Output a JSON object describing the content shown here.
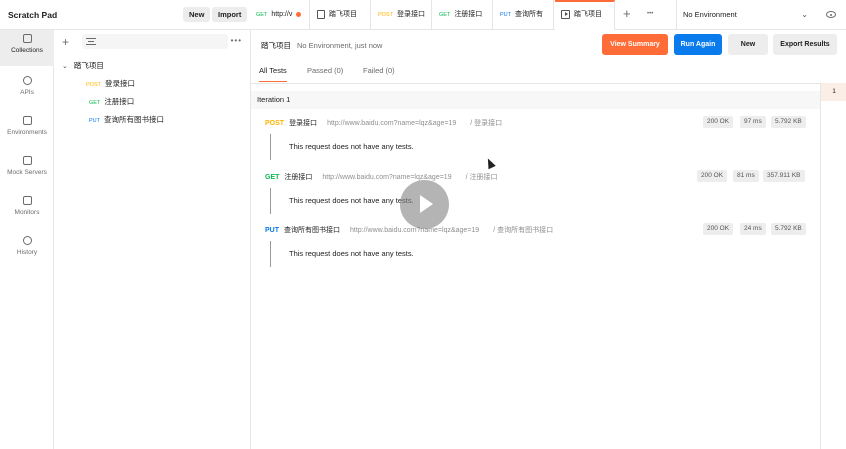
{
  "header": {
    "workspace": "Scratch Pad",
    "new_label": "New",
    "import_label": "Import"
  },
  "tabs": [
    {
      "method": "GET",
      "label": "http://v",
      "dirty": true
    },
    {
      "method": "",
      "label": "踏飞项目",
      "icon": "collection-icon"
    },
    {
      "method": "POST",
      "label": "登录接口"
    },
    {
      "method": "GET",
      "label": "注册接口"
    },
    {
      "method": "PUT",
      "label": "查询所有"
    },
    {
      "method": "",
      "label": "踏飞项目",
      "icon": "runner-icon",
      "active": true
    }
  ],
  "tab_controls": {
    "add": "+",
    "more": "•••"
  },
  "environment": {
    "selected": "No Environment",
    "chevron": "⌄"
  },
  "rail": [
    {
      "label": "Collections",
      "icon": "collections-icon",
      "active": true
    },
    {
      "label": "APIs",
      "icon": "apis-icon"
    },
    {
      "label": "Environments",
      "icon": "environments-icon"
    },
    {
      "label": "Mock Servers",
      "icon": "mock-servers-icon"
    },
    {
      "label": "Monitors",
      "icon": "monitors-icon"
    },
    {
      "label": "History",
      "icon": "history-icon"
    }
  ],
  "sidebar": {
    "add": "+",
    "more": "•••",
    "collection": "踏飞项目",
    "caret": "⌄",
    "requests": [
      {
        "method": "POST",
        "name": "登录接口"
      },
      {
        "method": "GET",
        "name": "注册接口"
      },
      {
        "method": "PUT",
        "name": "查询所有图书接口"
      }
    ]
  },
  "runner": {
    "title": "踏飞项目",
    "subtitle": "No Environment, just now",
    "buttons": {
      "view_summary": "View Summary",
      "run_again": "Run Again",
      "new": "New",
      "export": "Export Results"
    },
    "tabs": {
      "all": "All Tests",
      "passed": "Passed (0)",
      "failed": "Failed (0)"
    },
    "iteration": "Iteration 1",
    "iteration_number": "1",
    "results": [
      {
        "method": "POST",
        "name": "登录接口",
        "url": "http://www.baidu.com?name=lqz&age=19",
        "path": "/ 登录接口",
        "status": "200 OK",
        "time": "97 ms",
        "size": "5.792 KB",
        "note": "This request does not have any tests."
      },
      {
        "method": "GET",
        "name": "注册接口",
        "url": "http://www.baidu.com?name=lqz&age=19",
        "path": "/ 注册接口",
        "status": "200 OK",
        "time": "81 ms",
        "size": "357.911 KB",
        "note": "This request does not have any tests."
      },
      {
        "method": "PUT",
        "name": "查询所有图书接口",
        "url": "http://www.baidu.com?name=lqz&age=19",
        "path": "/ 查询所有图书接口",
        "status": "200 OK",
        "time": "24 ms",
        "size": "5.792 KB",
        "note": "This request does not have any tests."
      }
    ]
  },
  "colors": {
    "accent": "#ff6c37",
    "primary": "#097bed",
    "get": "#0cbb52",
    "post": "#ffb400",
    "put": "#097bed"
  }
}
